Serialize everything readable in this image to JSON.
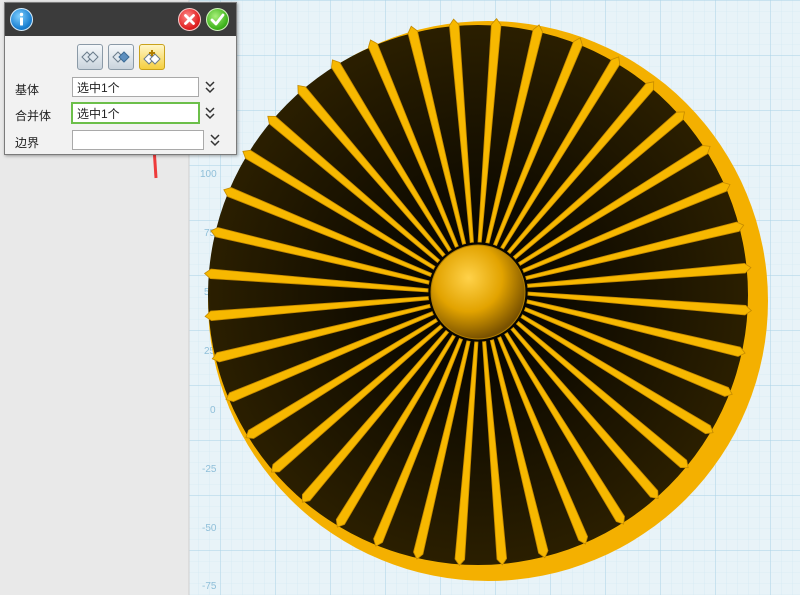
{
  "panel": {
    "info_icon": "info-icon",
    "cancel_icon": "close-icon",
    "confirm_icon": "checkmark-icon",
    "mode_buttons": [
      {
        "icon": "subtract-mode-icon",
        "active": false
      },
      {
        "icon": "intersect-mode-icon",
        "active": false
      },
      {
        "icon": "union-mode-icon",
        "active": true
      }
    ],
    "fields": [
      {
        "label": "基体",
        "value": "选中1个",
        "placeholder": ""
      },
      {
        "label": "合并体",
        "value": "选中1个",
        "placeholder": ""
      },
      {
        "label": "边界",
        "value": "",
        "placeholder": ""
      }
    ]
  },
  "viewport": {
    "ruler_labels": [
      "100",
      "75",
      "50",
      "25",
      "0",
      "-25",
      "-50",
      "-75"
    ],
    "grid_color": "#bfe0ef",
    "model_color": "#f7b800",
    "model_shade_color": "#2a1d00",
    "model": "turbine-fan-model"
  },
  "annotation": {
    "color": "#ee3b3b",
    "icon": "red-arrow-icon"
  }
}
